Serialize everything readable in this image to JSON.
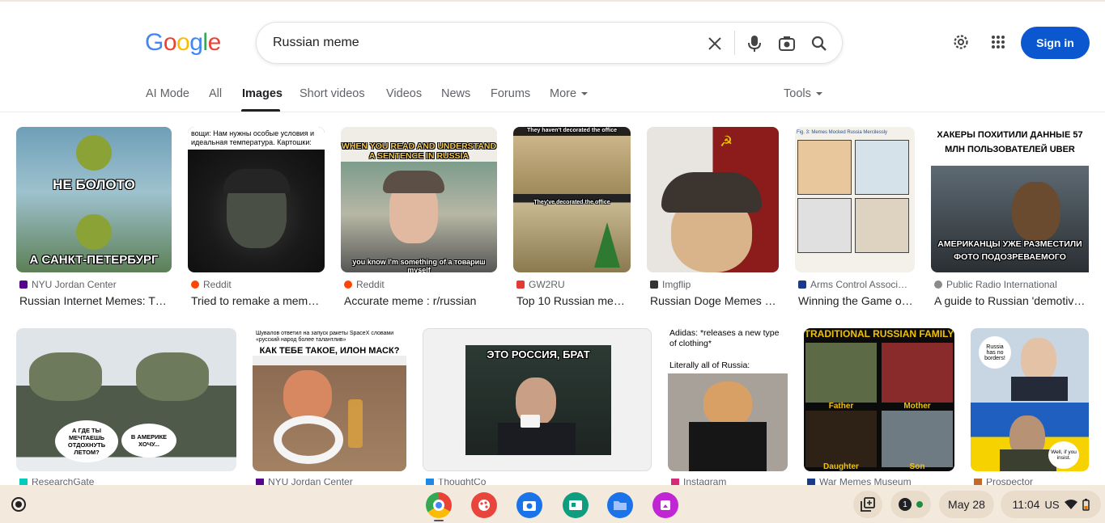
{
  "search": {
    "query": "Russian meme"
  },
  "header": {
    "logo_letters": [
      "G",
      "o",
      "o",
      "g",
      "l",
      "e"
    ],
    "signin_label": "Sign in"
  },
  "tabs": [
    {
      "label": "AI Mode"
    },
    {
      "label": "All"
    },
    {
      "label": "Images"
    },
    {
      "label": "Short videos"
    },
    {
      "label": "Videos"
    },
    {
      "label": "News"
    },
    {
      "label": "Forums"
    },
    {
      "label": "More"
    }
  ],
  "tools_label": "Tools",
  "results_row1": [
    {
      "source": "NYU Jordan Center",
      "title": "Russian Internet Memes: T…",
      "meme_top": "НЕ БОЛОТО",
      "meme_bottom": "А САНКТ-ПЕТЕРБУРГ",
      "fav_color": "#57068c"
    },
    {
      "source": "Reddit",
      "title": "Tried to remake a meme…",
      "caption": "вощи: Нам нужны особые условия и идеальная температура. Картошки:",
      "fav_color": "#ff4500"
    },
    {
      "source": "Reddit",
      "title": "Accurate meme : r/russian",
      "meme_top": "WHEN YOU READ AND UNDERSTAND A SENTENCE IN RUSSIA",
      "meme_bottom": "you know I'm something of a товариш myself",
      "fav_color": "#ff4500"
    },
    {
      "source": "GW2RU",
      "title": "Top 10 Russian me…",
      "meme_top": "They haven't decorated the office",
      "meme_bottom": "They've decorated the office",
      "fav_color": "#e53935"
    },
    {
      "source": "Imgflip",
      "title": "Russian Doge Memes -…",
      "fav_color": "#333333"
    },
    {
      "source": "Arms Control Associ…",
      "title": "Winning the Game o…",
      "caption": "Fig. 3: Memes Mocked Russia Mercilessly",
      "fav_color": "#1a3a8a"
    },
    {
      "source": "Public Radio International",
      "title": "A guide to Russian 'demotiv…",
      "meme_top": "ХАКЕРЫ ПОХИТИЛИ ДАННЫЕ 57 МЛН ПОЛЬЗОВАТЕЛЕЙ UBER",
      "meme_bottom": "АМЕРИКАНЦЫ УЖЕ РАЗМЕСТИЛИ ФОТО ПОДОЗРЕВАЕМОГО",
      "fav_color": "#8a8a8a"
    }
  ],
  "results_row2": [
    {
      "source": "ResearchGate",
      "bubble1": "А ГДЕ ТЫ МЕЧТАЕШЬ ОТДОХНУТЬ ЛЕТОМ?",
      "bubble2": "В АМЕРИКЕ ХОЧУ..."
    },
    {
      "source": "NYU Jordan Center",
      "caption": "Шувалов ответил на запуск ракеты SpaceX словами «русский народ более талантлив»",
      "meme_top": "КАК ТЕБЕ ТАКОЕ, ИЛОН МАСК?"
    },
    {
      "source": "ThoughtCo",
      "meme_top": "ЭТО РОССИЯ, БРАТ"
    },
    {
      "source": "Instagram",
      "caption_line1": "Adidas: *releases a new type of clothing*",
      "caption_line2": "Literally all of Russia:"
    },
    {
      "source": "War Memes Museum",
      "meme_top": "TRADITIONAL RUSSIAN FAMILY",
      "labels": [
        "Father",
        "Mother",
        "Daughter",
        "Son"
      ]
    },
    {
      "source": "Prospector",
      "bubble1": "Russia has no borders!",
      "bubble2": "Well, if you insist."
    }
  ],
  "taskbar": {
    "notification_count": "1",
    "date": "May 28",
    "time": "11:04",
    "locale": "US"
  }
}
